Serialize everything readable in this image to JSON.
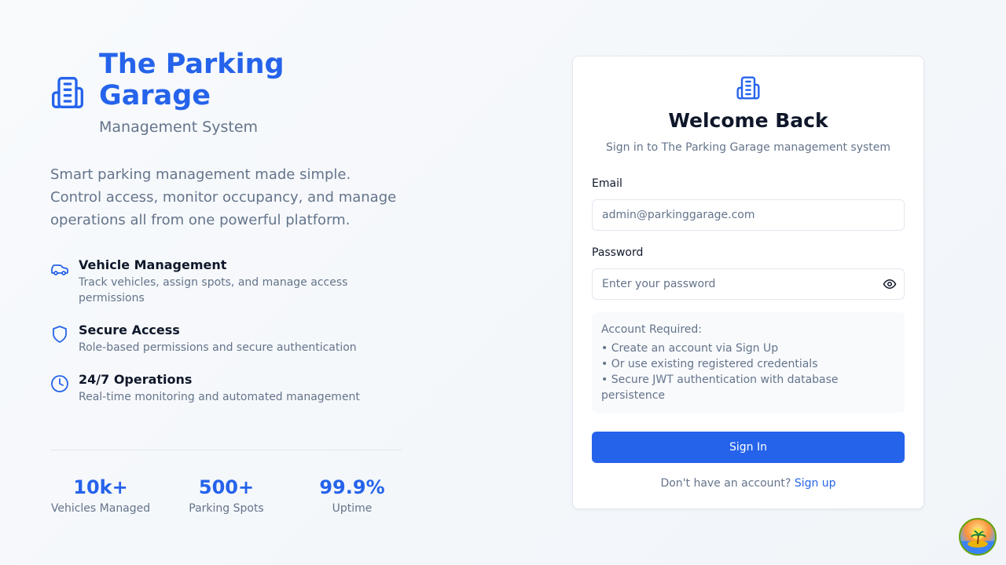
{
  "brand": {
    "title": "The Parking Garage",
    "subtitle": "Management System",
    "icon": "building-icon"
  },
  "intro": "Smart parking management made simple. Control access, monitor occupancy, and manage operations all from one powerful platform.",
  "features": [
    {
      "icon": "car-icon",
      "title": "Vehicle Management",
      "description": "Track vehicles, assign spots, and manage access permissions"
    },
    {
      "icon": "shield-icon",
      "title": "Secure Access",
      "description": "Role-based permissions and secure authentication"
    },
    {
      "icon": "clock-icon",
      "title": "24/7 Operations",
      "description": "Real-time monitoring and automated management"
    }
  ],
  "stats": [
    {
      "value": "10k+",
      "label": "Vehicles Managed"
    },
    {
      "value": "500+",
      "label": "Parking Spots"
    },
    {
      "value": "99.9%",
      "label": "Uptime"
    }
  ],
  "login": {
    "title": "Welcome Back",
    "subtitle": "Sign in to The Parking Garage management system",
    "email_label": "Email",
    "email_placeholder": "admin@parkinggarage.com",
    "email_value": "",
    "password_label": "Password",
    "password_placeholder": "Enter your password",
    "password_value": "",
    "info_title": "Account Required:",
    "info_items": [
      "• Create an account via Sign Up",
      "• Or use existing registered credentials",
      "• Secure JWT authentication with database persistence"
    ],
    "submit_label": "Sign In",
    "signup_prompt": "Don't have an account?",
    "signup_link": "Sign up"
  },
  "colors": {
    "accent": "#2563eb",
    "muted_text": "#64748b",
    "text": "#0f172a",
    "border": "#e2e8f0"
  }
}
